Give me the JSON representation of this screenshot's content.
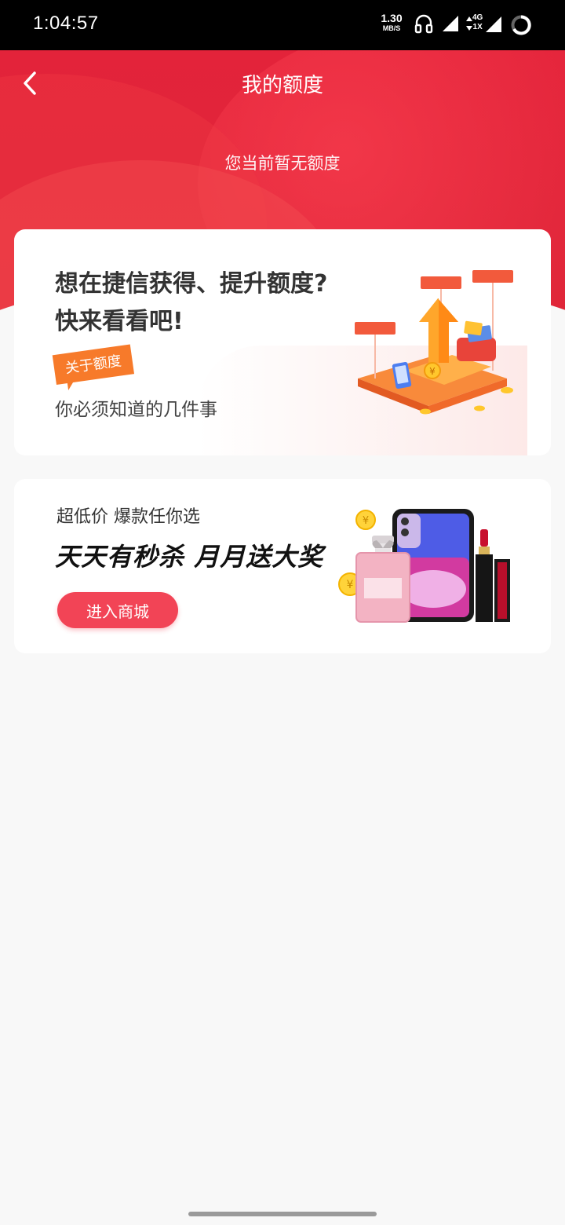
{
  "status_bar": {
    "time": "1:04:57",
    "net_speed": "1.30",
    "net_speed_unit": "MB/S",
    "net_type_top": "4G",
    "net_type_bottom": "1X",
    "icons": [
      "headphones-icon",
      "signal-icon",
      "signal-4g-icon",
      "battery-ring-icon"
    ]
  },
  "header": {
    "title": "我的额度",
    "back_icon": "chevron-left-icon"
  },
  "hero": {
    "quota_status": "您当前暂无额度"
  },
  "quota_card": {
    "title_line1": "想在捷信获得、提升额度?",
    "title_line2": "快来看看吧!",
    "tag": "关于额度",
    "subtitle": "你必须知道的几件事"
  },
  "mall_card": {
    "subtitle": "超低价 爆款任你选",
    "title": "天天有秒杀 月月送大奖",
    "button": "进入商城"
  },
  "colors": {
    "brand_red": "#e3233a",
    "button_red": "#f24456",
    "tag_orange": "#f77a2a",
    "background": "#f8f8f8"
  }
}
